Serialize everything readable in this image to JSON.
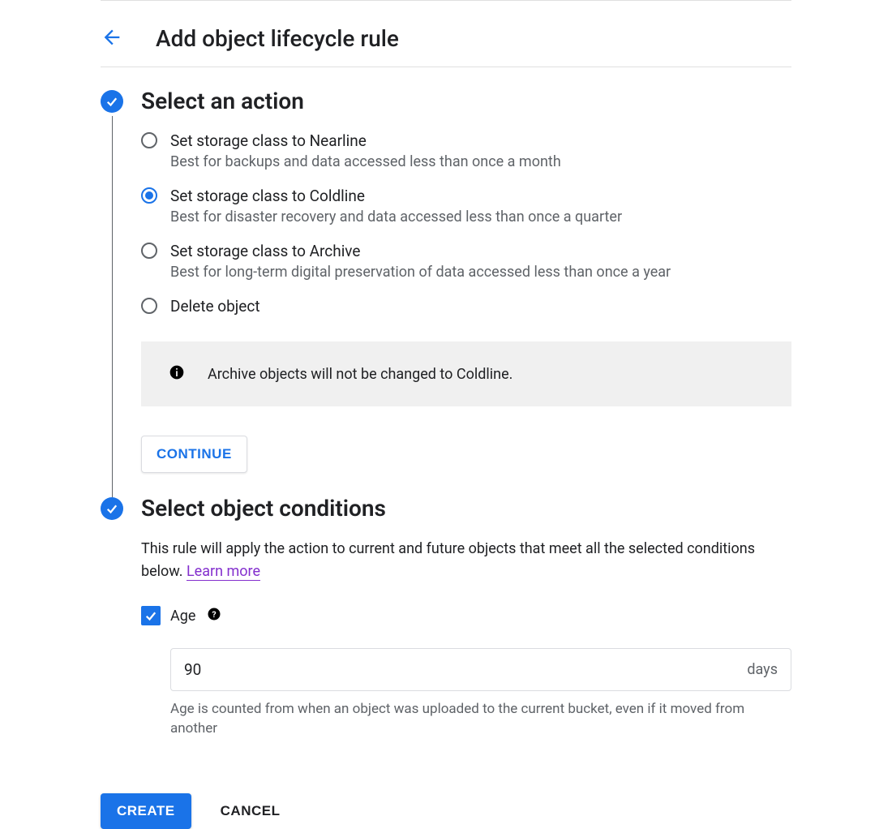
{
  "header": {
    "title": "Add object lifecycle rule"
  },
  "step1": {
    "title": "Select an action",
    "options": [
      {
        "label": "Set storage class to Nearline",
        "desc": "Best for backups and data accessed less than once a month",
        "selected": false
      },
      {
        "label": "Set storage class to Coldline",
        "desc": "Best for disaster recovery and data accessed less than once a quarter",
        "selected": true
      },
      {
        "label": "Set storage class to Archive",
        "desc": "Best for long-term digital preservation of data accessed less than once a year",
        "selected": false
      },
      {
        "label": "Delete object",
        "desc": "",
        "selected": false
      }
    ],
    "info_text": "Archive objects will not be changed to Coldline.",
    "continue_label": "CONTINUE"
  },
  "step2": {
    "title": "Select object conditions",
    "desc_prefix": "This rule will apply the action to current and future objects that meet all the selected conditions below. ",
    "learn_more": "Learn more",
    "age": {
      "label": "Age",
      "checked": true,
      "value": "90",
      "suffix": "days",
      "help": "Age is counted from when an object was uploaded to the current bucket, even if it moved from another"
    }
  },
  "footer": {
    "create_label": "CREATE",
    "cancel_label": "CANCEL"
  }
}
